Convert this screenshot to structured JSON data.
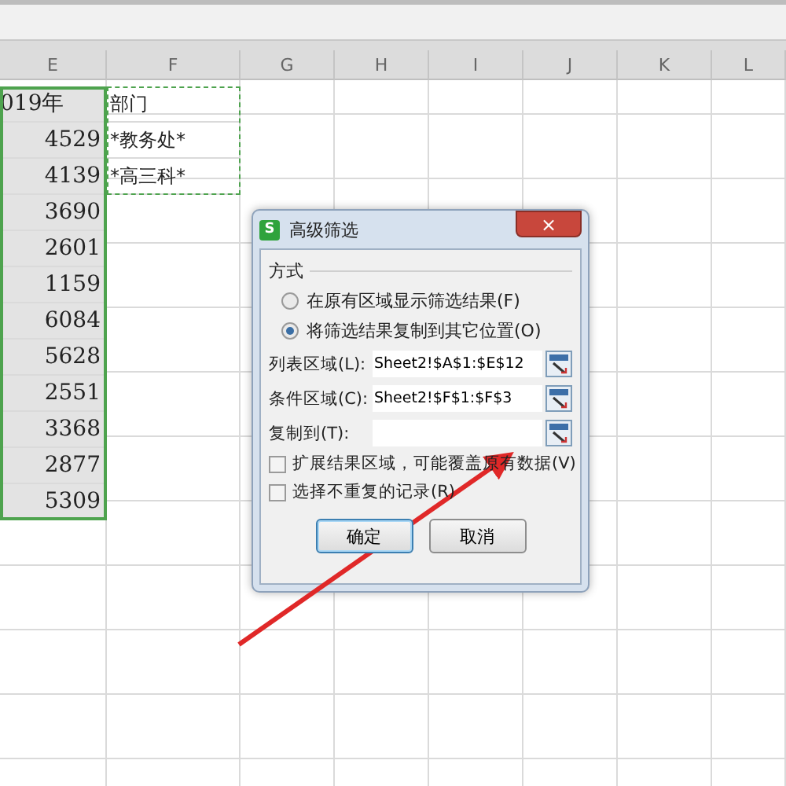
{
  "columns": [
    {
      "label": "E"
    },
    {
      "label": "F"
    },
    {
      "label": "G"
    },
    {
      "label": "H"
    },
    {
      "label": "I"
    },
    {
      "label": "J"
    },
    {
      "label": "K"
    },
    {
      "label": "L"
    }
  ],
  "rows": [
    {
      "column_e": "019年",
      "column_f": "部门"
    },
    {
      "column_e": "4529",
      "column_f": "*教务处*"
    },
    {
      "column_e": "4139",
      "column_f": "*高三科*"
    },
    {
      "column_e": "3690"
    },
    {
      "column_e": "2601"
    },
    {
      "column_e": "1159"
    },
    {
      "column_e": "6084"
    },
    {
      "column_e": "5628"
    },
    {
      "column_e": "2551"
    },
    {
      "column_e": "3368"
    },
    {
      "column_e": "2877"
    },
    {
      "column_e": "5309"
    }
  ],
  "dialog": {
    "icon_text": "S",
    "title": "高级筛选",
    "close_label": "×",
    "group_label": "方式",
    "options": [
      {
        "label": "在原有区域显示筛选结果(F)",
        "selected": false
      },
      {
        "label": "将筛选结果复制到其它位置(O)",
        "selected": true
      }
    ],
    "fields": [
      {
        "label": "列表区域(L):",
        "value": "Sheet2!$A$1:$E$12"
      },
      {
        "label": "条件区域(C):",
        "value": "Sheet2!$F$1:$F$3"
      },
      {
        "label": "复制到(T):"
      }
    ],
    "checkboxes": [
      {
        "label": "扩展结果区域，可能覆盖原有数据(V)",
        "checked": false
      },
      {
        "label": "选择不重复的记录(R)",
        "checked": false
      }
    ],
    "buttons": [
      {
        "label": "确定",
        "default": true
      },
      {
        "label": "取消",
        "default": false
      }
    ]
  }
}
